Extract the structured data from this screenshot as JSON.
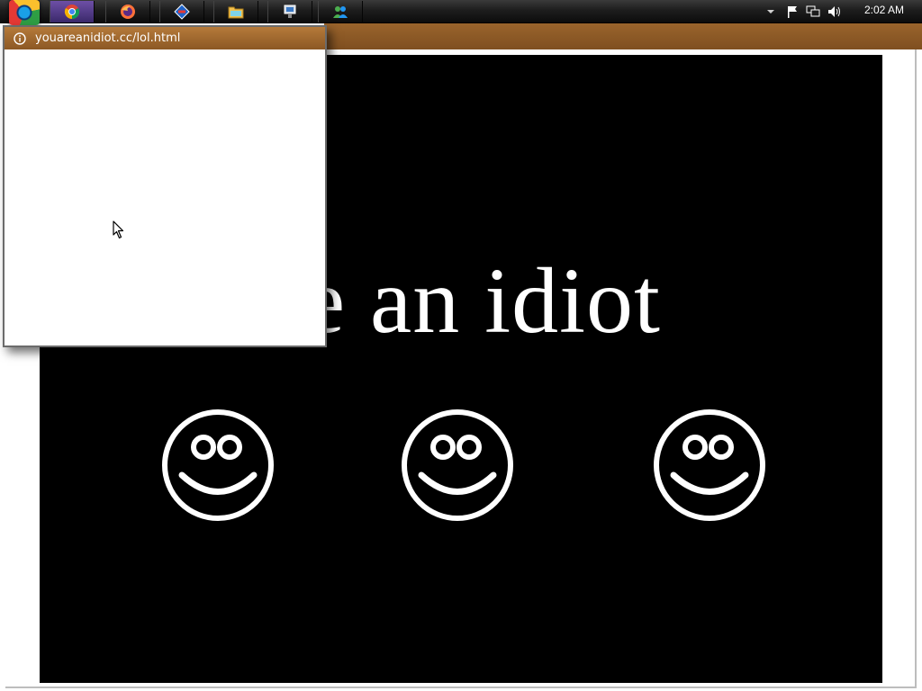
{
  "taskbar": {
    "apps": [
      {
        "name": "chrome",
        "icon": "chrome-icon"
      },
      {
        "name": "firefox",
        "icon": "firefox-icon"
      },
      {
        "name": "app3",
        "icon": "blue-app-icon"
      },
      {
        "name": "file-explorer",
        "icon": "folder-icon"
      },
      {
        "name": "app5",
        "icon": "network-app-icon"
      },
      {
        "name": "app6",
        "icon": "people-icon"
      }
    ],
    "tray": {
      "icons": [
        "chevron-down-icon",
        "flag-icon",
        "network-icon",
        "volume-icon"
      ],
      "clock": "2:02 AM"
    }
  },
  "popup": {
    "url": "youareanidiot.cc/lol.html",
    "icon": "info-icon"
  },
  "page": {
    "headline": "are an idiot",
    "smiley_count": 3
  },
  "colors": {
    "popup_bar": "#9a642c",
    "page_background": "#000000",
    "text": "#ffffff"
  }
}
